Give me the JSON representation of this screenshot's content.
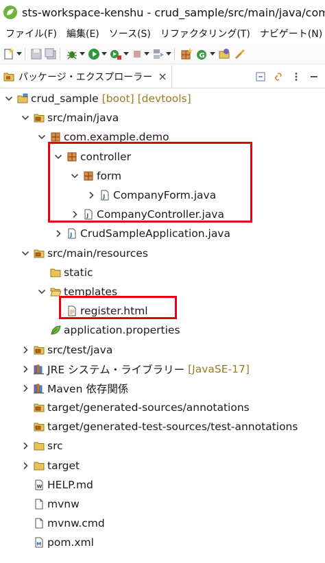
{
  "window": {
    "title": "sts-workspace-kenshu - crud_sample/src/main/java/com/example/demo"
  },
  "menubar": {
    "items": [
      "ファイル(F)",
      "編集(E)",
      "ソース(S)",
      "リファクタリング(T)",
      "ナビゲート(N)"
    ]
  },
  "view": {
    "tab_label": "パッケージ・エクスプローラー",
    "close_glyph": "×"
  },
  "tree": {
    "project": {
      "label": "crud_sample",
      "decoration": "[boot] [devtools]"
    },
    "src_main_java": {
      "label": "src/main/java"
    },
    "pkg_demo": {
      "label": "com.example.demo"
    },
    "pkg_controller": {
      "label": "controller"
    },
    "pkg_form": {
      "label": "form"
    },
    "file_companyform": {
      "label": "CompanyForm.java"
    },
    "file_companycontroller": {
      "label": "CompanyController.java"
    },
    "file_crudsampleapp": {
      "label": "CrudSampleApplication.java"
    },
    "src_main_resources": {
      "label": "src/main/resources"
    },
    "folder_static": {
      "label": "static"
    },
    "folder_templates": {
      "label": "templates"
    },
    "file_register": {
      "label": "register.html"
    },
    "file_appprops": {
      "label": "application.properties"
    },
    "src_test_java": {
      "label": "src/test/java"
    },
    "jre_library": {
      "label": "JRE システム・ライブラリー",
      "decoration": "[JavaSE-17]"
    },
    "maven_deps": {
      "label": "Maven 依存関係"
    },
    "target_gen_sources": {
      "label": "target/generated-sources/annotations"
    },
    "target_gen_test_sources": {
      "label": "target/generated-test-sources/test-annotations"
    },
    "folder_src": {
      "label": "src"
    },
    "folder_target": {
      "label": "target"
    },
    "file_help": {
      "label": "HELP.md"
    },
    "file_mvnw": {
      "label": "mvnw"
    },
    "file_mvnwcmd": {
      "label": "mvnw.cmd"
    },
    "file_pom": {
      "label": "pom.xml"
    }
  },
  "colors": {
    "highlight": "#e60012",
    "decoration": "#9a7b26",
    "package": "#b5651d",
    "folder": "#e8c25a"
  }
}
